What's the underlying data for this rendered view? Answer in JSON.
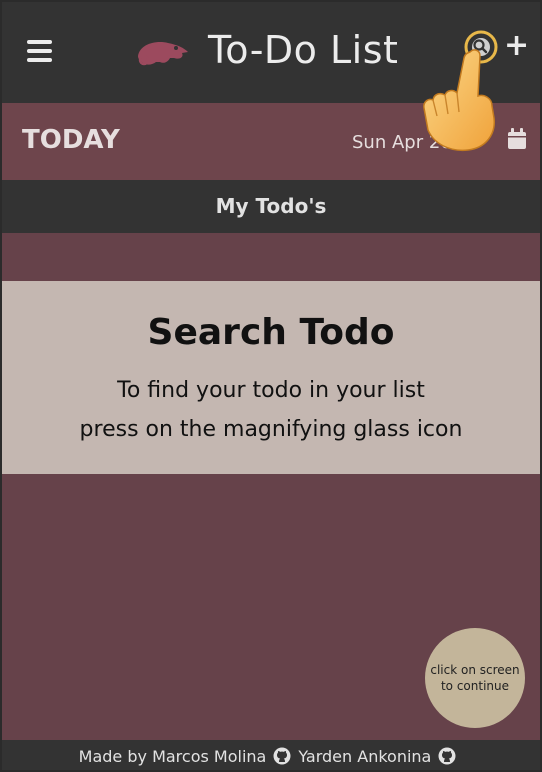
{
  "header": {
    "title": "To-Do List",
    "menu_icon": "hamburger-menu-icon",
    "logo_icon": "chameleon-logo-icon",
    "search_icon": "magnifying-glass-icon",
    "add_icon": "plus-icon",
    "add_label": "+"
  },
  "today": {
    "label": "TODAY",
    "date": "Sun Apr    2020",
    "calendar_icon": "calendar-icon"
  },
  "section": {
    "title": "My Todo's"
  },
  "tooltip": {
    "title": "Search Todo",
    "line1": "To find your todo in your list",
    "line2": "press on the magnifying glass icon"
  },
  "continue": {
    "line1": "click on screen",
    "line2": "to continue"
  },
  "footer": {
    "prefix": "Made by",
    "author1": "Marcos Molina",
    "author2": "Yarden Ankonina",
    "link_icon": "github-icon"
  },
  "colors": {
    "background": "#66424a",
    "topbar": "#333333",
    "today_bar": "#6e454c",
    "tooltip_panel": "#c4b7b1",
    "continue_button": "#c3b59a",
    "logo": "#9c4a5e",
    "hand": "#f4b64a"
  }
}
